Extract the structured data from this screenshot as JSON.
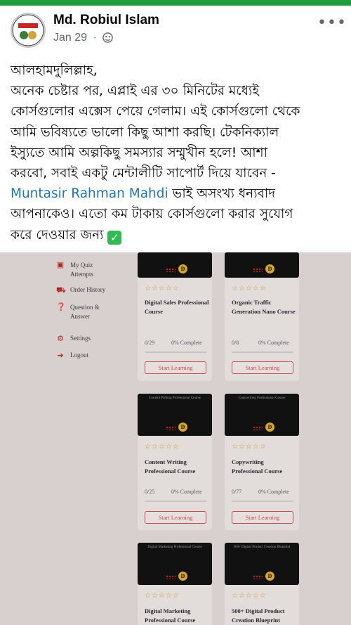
{
  "post": {
    "author": "Md. Robiul Islam",
    "date": "Jan 29",
    "separator": "·",
    "privacy_icon": "friends-icon",
    "more_label": "•••",
    "avatar_text": "OFF LINE",
    "lines": [
      "আলহামদুলিল্লাহ,",
      "অনেক চেষ্টার পর, এপ্লাই এর ৩০ মিনিটের মধ্যেই",
      "কোর্সগুলোর এক্সেস পেয়ে গেলাম। এই কোর্সগুলো থেকে",
      "আমি ভবিষ্যতে ভালো কিছু আশা করছি। টেকনিক্যাল",
      "ইস্যুতে আমি অল্পকিছু  সমস্যার সম্মুখীন হলে! আশা",
      "করবো, সবাই একটু মেন্টালীটি সাপোর্ট দিয়ে যাবেন -"
    ],
    "mention": "Muntasir Rahman Mahdi",
    "mention_suffix": " ভাই অসংখ্য ধন্যবাদ",
    "line8": "আপনাকেও।  এতো কম টাকায় কোর্সগুলো করার সুযোগ",
    "line9": "করে দেওয়ার জন্য ",
    "check_glyph": "✓"
  },
  "sidebar": {
    "quiz": "My Quiz Attempts",
    "orders": "Order History",
    "qa": "Question & Answer",
    "settings": "Settings",
    "logout": "Logout"
  },
  "stars": "☆☆☆☆☆",
  "courses": [
    {
      "thumb": "Digital Sales Professional Course",
      "title": "Digital Sales Professional Course",
      "count": "0/29",
      "pct": "0% Complete",
      "button": "Start Learning"
    },
    {
      "thumb": "Organic Traffic Generation",
      "title": "Organic Traffic Generation Nano Course",
      "count": "0/8",
      "pct": "0% Complete",
      "button": "Start Learning"
    },
    {
      "thumb": "Content Writing Professional Course",
      "title": "Content Writing Professional Course",
      "count": "0/25",
      "pct": "0% Complete",
      "button": "Start Learning"
    },
    {
      "thumb": "Copywriting Professional Course",
      "title": "Copywriting Professional Course",
      "count": "0/77",
      "pct": "0% Complete",
      "button": "Start Learning"
    },
    {
      "thumb": "Digital Marketing Professional Course",
      "title": "Digital Marketing Professional Course",
      "count": "",
      "pct": "",
      "button": ""
    },
    {
      "thumb": "500+ Digital Product Creation Blueprint",
      "title": "500+ Digital Product Creation Blueprint",
      "count": "",
      "pct": "",
      "button": ""
    }
  ],
  "logo_letter": "D"
}
